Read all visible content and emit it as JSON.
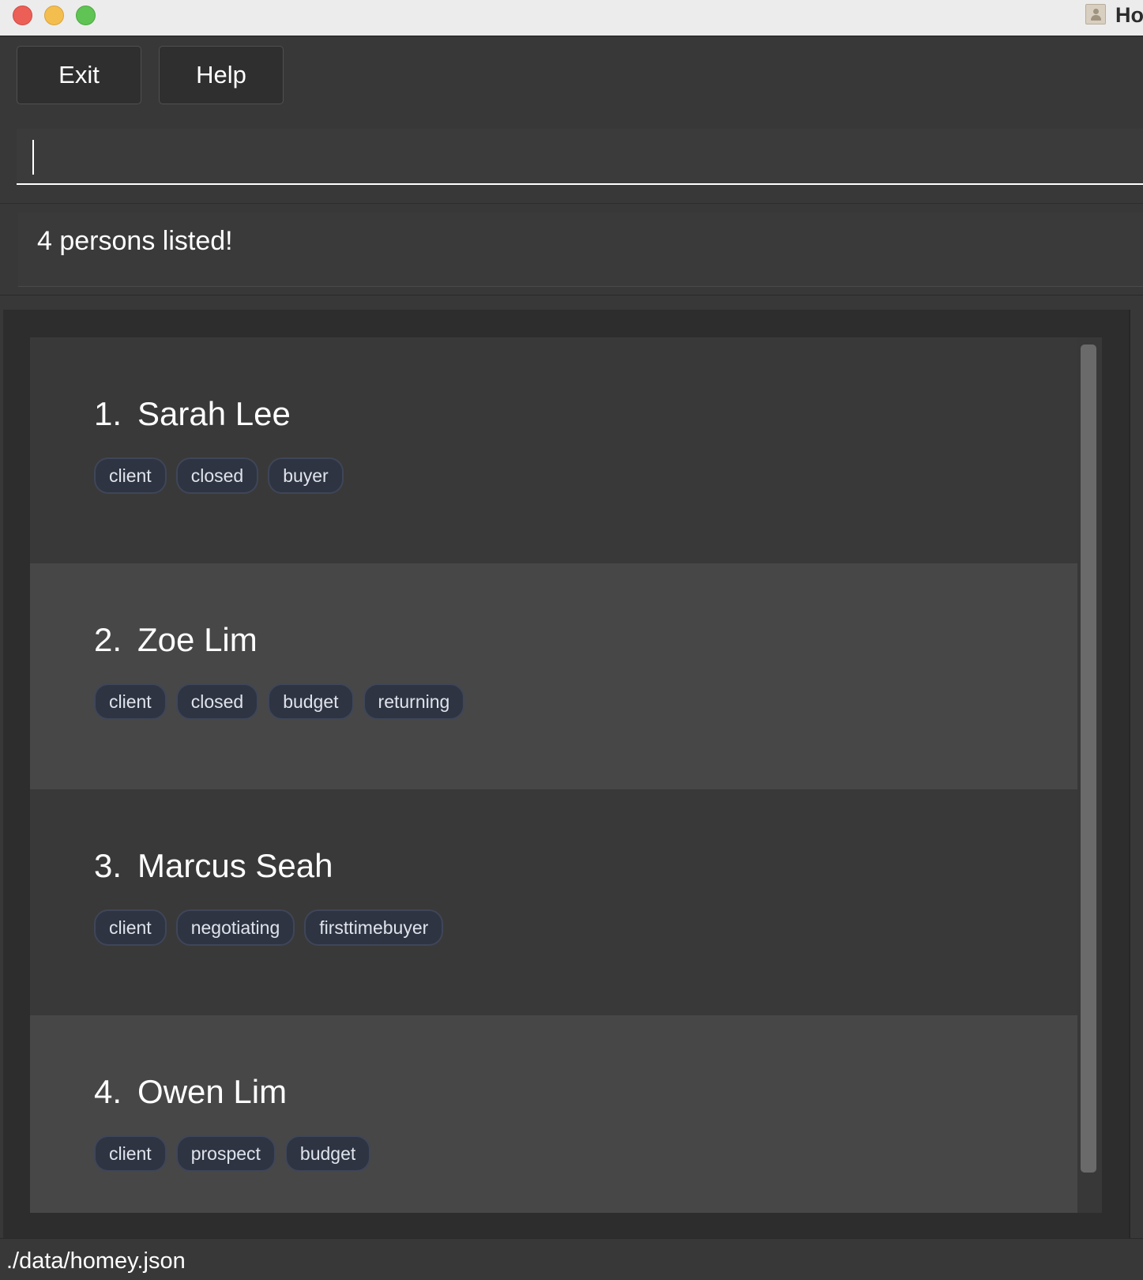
{
  "window": {
    "title": "Ho",
    "app_icon": "contact-book-icon"
  },
  "menu": {
    "exit_label": "Exit",
    "help_label": "Help"
  },
  "command": {
    "value": ""
  },
  "result": {
    "message": "4 persons listed!"
  },
  "persons": [
    {
      "index": "1.",
      "name": "Sarah Lee",
      "tags": [
        "client",
        "closed",
        "buyer"
      ]
    },
    {
      "index": "2.",
      "name": "Zoe Lim",
      "tags": [
        "client",
        "closed",
        "budget",
        "returning"
      ]
    },
    {
      "index": "3.",
      "name": "Marcus Seah",
      "tags": [
        "client",
        "negotiating",
        "firsttimebuyer"
      ]
    },
    {
      "index": "4.",
      "name": "Owen Lim",
      "tags": [
        "client",
        "prospect",
        "budget"
      ]
    }
  ],
  "status_bar": {
    "file_path": "./data/homey.json"
  },
  "colors": {
    "background": "#383838",
    "card_odd": "#393939",
    "card_even": "#474747",
    "tag_background": "#2e3442",
    "text": "#ffffff"
  }
}
